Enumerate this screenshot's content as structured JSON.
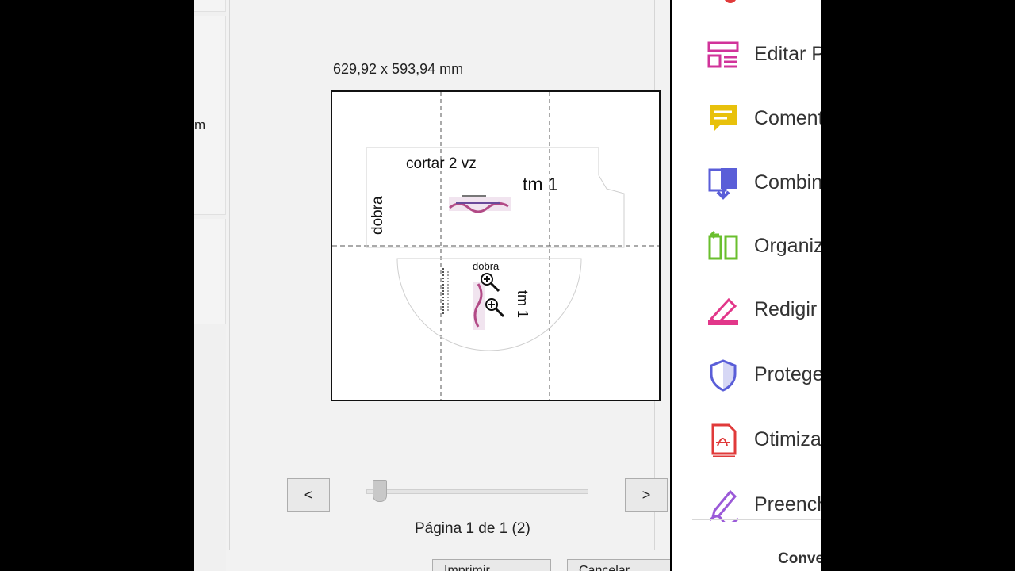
{
  "dialog": {
    "cut_left_label": "m",
    "page_size": "629,92 x 593,94 mm",
    "prev_label": "<",
    "next_label": ">",
    "page_indicator": "Página 1 de 1 (2)",
    "slider_position": 0.03,
    "print_label": "Imprimir",
    "cancel_label": "Cancelar"
  },
  "preview": {
    "text_cut": "cortar 2 vz",
    "text_fold_vertical": "dobra",
    "text_size_top": "tm 1",
    "text_fold_bottom": "dobra",
    "text_size_bottom": "tm 1"
  },
  "tools": {
    "items": [
      {
        "label": "Editar PDF",
        "icon": "edit-pdf-icon",
        "color": "#d1339a"
      },
      {
        "label": "Comentário",
        "icon": "comment-icon",
        "color": "#e8c10c"
      },
      {
        "label": "Combinar arquivos",
        "icon": "combine-files-icon",
        "color": "#5a5ed8"
      },
      {
        "label": "Organizar páginas",
        "icon": "organize-pages-icon",
        "color": "#6abf2e"
      },
      {
        "label": "Redigir",
        "icon": "redact-icon",
        "color": "#e2378a"
      },
      {
        "label": "Proteger",
        "icon": "protect-icon",
        "color": "#5a5ed8"
      },
      {
        "label": "Otimizar PDF",
        "icon": "optimize-pdf-icon",
        "color": "#e03a3a"
      },
      {
        "label": "Preencher e assinar",
        "icon": "fill-sign-icon",
        "color": "#9b5ad8"
      }
    ],
    "convert_label": "Converter"
  }
}
